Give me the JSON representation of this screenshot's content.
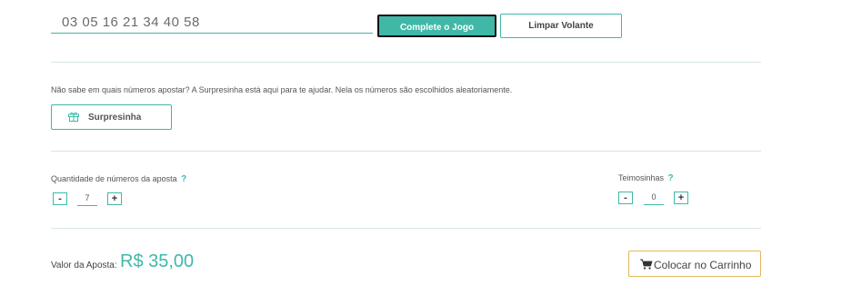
{
  "numbers": {
    "selected": "03  05  16  21  34  40  58"
  },
  "actions": {
    "complete_label": "Complete o Jogo",
    "clear_label": "Limpar Volante"
  },
  "surprise": {
    "help_text": "Não sabe em quais números apostar? A Surpresinha está aqui para te ajudar. Nela os números são escolhidos aleatoriamente.",
    "button_label": "Surpresinha",
    "icon": "gift-icon"
  },
  "quantity": {
    "label": "Quantidade de números da aposta",
    "help": "?",
    "decrement": "-",
    "value": "7",
    "increment": "+"
  },
  "teimosinhas": {
    "label": "Teimosinhas",
    "help": "?",
    "decrement": "-",
    "value": "0",
    "increment": "+"
  },
  "valor": {
    "label": "Valor da Aposta:",
    "amount": "R$ 35,00"
  },
  "cart": {
    "label": "Colocar no Carrinho",
    "icon": "cart-icon"
  },
  "colors": {
    "accent": "#3fb8a8",
    "cart_border": "#e0b85c"
  }
}
